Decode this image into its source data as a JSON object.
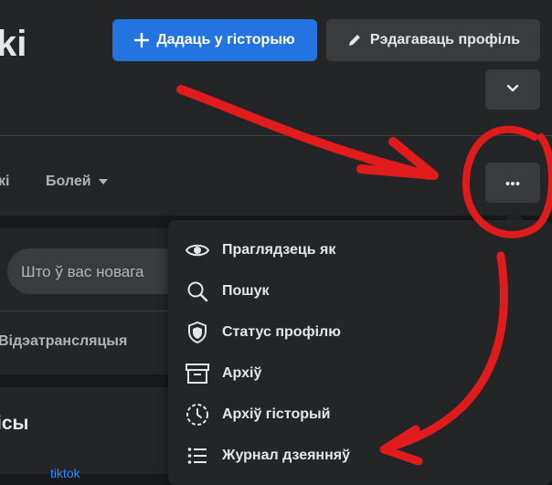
{
  "profile": {
    "name_fragment": "ki"
  },
  "header": {
    "add_story_label": "Дадаць у гісторыю",
    "edit_profile_label": "Рэдагаваць профіль"
  },
  "tabs": {
    "fragment": "кі",
    "more_label": "Болей"
  },
  "composer": {
    "placeholder": "Што ў вас новага",
    "live_label": "Відэатрансляцыя"
  },
  "section": {
    "title_fragment": "ісы",
    "link_fragment": "tiktok"
  },
  "menu": {
    "items": [
      {
        "label": "Праглядзець як",
        "icon": "eye-icon"
      },
      {
        "label": "Пошук",
        "icon": "search-icon"
      },
      {
        "label": "Статус профілю",
        "icon": "shield-icon"
      },
      {
        "label": "Архіў",
        "icon": "archive-icon"
      },
      {
        "label": "Архіў гісторый",
        "icon": "story-archive-icon"
      },
      {
        "label": "Журнал дзеянняў",
        "icon": "list-icon"
      }
    ]
  },
  "colors": {
    "accent": "#2374e1",
    "annotation": "#e01b1b",
    "surface": "#242526",
    "background": "#18191a"
  }
}
